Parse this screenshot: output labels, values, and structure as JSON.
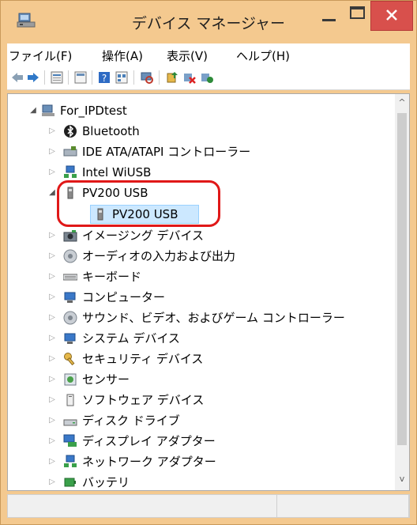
{
  "window": {
    "title": "デバイス マネージャー",
    "accent": "#f4c98f",
    "close_color": "#d8504c"
  },
  "titlebar_buttons": {
    "minimize_icon": "minimize-icon",
    "maximize_icon": "maximize-icon",
    "close_glyph": "×"
  },
  "menu": [
    {
      "label": "ファイル(F)"
    },
    {
      "label": "操作(A)"
    },
    {
      "label": "表示(V)"
    },
    {
      "label": "ヘルプ(H)"
    }
  ],
  "toolbar": {
    "icons": [
      "back-icon",
      "forward-icon",
      "properties-icon",
      "show-hide-icon",
      "help-icon",
      "view-icon",
      "scan-hardware-icon",
      "update-driver-icon",
      "uninstall-icon",
      "enable-icon"
    ]
  },
  "tree": {
    "root": "For_IPDtest",
    "items": [
      {
        "label": "Bluetooth",
        "icon": "bluetooth-icon"
      },
      {
        "label": "IDE ATA/ATAPI コントローラー",
        "icon": "ide-controller-icon"
      },
      {
        "label": "Intel WiUSB",
        "icon": "network-icon"
      },
      {
        "label": "PV200 USB",
        "icon": "usb-device-icon"
      },
      {
        "label": "PV200 USB",
        "icon": "usb-device-icon"
      },
      {
        "label": "イメージング デバイス",
        "icon": "camera-icon"
      },
      {
        "label": "オーディオの入力および出力",
        "icon": "speaker-icon"
      },
      {
        "label": "キーボード",
        "icon": "keyboard-icon"
      },
      {
        "label": "コンピューター",
        "icon": "computer-icon"
      },
      {
        "label": "サウンド、ビデオ、およびゲーム コントローラー",
        "icon": "sound-icon"
      },
      {
        "label": "システム デバイス",
        "icon": "system-device-icon"
      },
      {
        "label": "セキュリティ デバイス",
        "icon": "security-key-icon"
      },
      {
        "label": "センサー",
        "icon": "sensor-icon"
      },
      {
        "label": "ソフトウェア デバイス",
        "icon": "software-device-icon"
      },
      {
        "label": "ディスク ドライブ",
        "icon": "disk-drive-icon"
      },
      {
        "label": "ディスプレイ アダプター",
        "icon": "display-adapter-icon"
      },
      {
        "label": "ネットワーク アダプター",
        "icon": "network-adapter-icon"
      },
      {
        "label": "バッテリ",
        "icon": "battery-icon"
      }
    ]
  },
  "glyphs": {
    "expanded": "◢",
    "collapsed": "▷",
    "scroll_up": "^",
    "scroll_down": "v"
  }
}
